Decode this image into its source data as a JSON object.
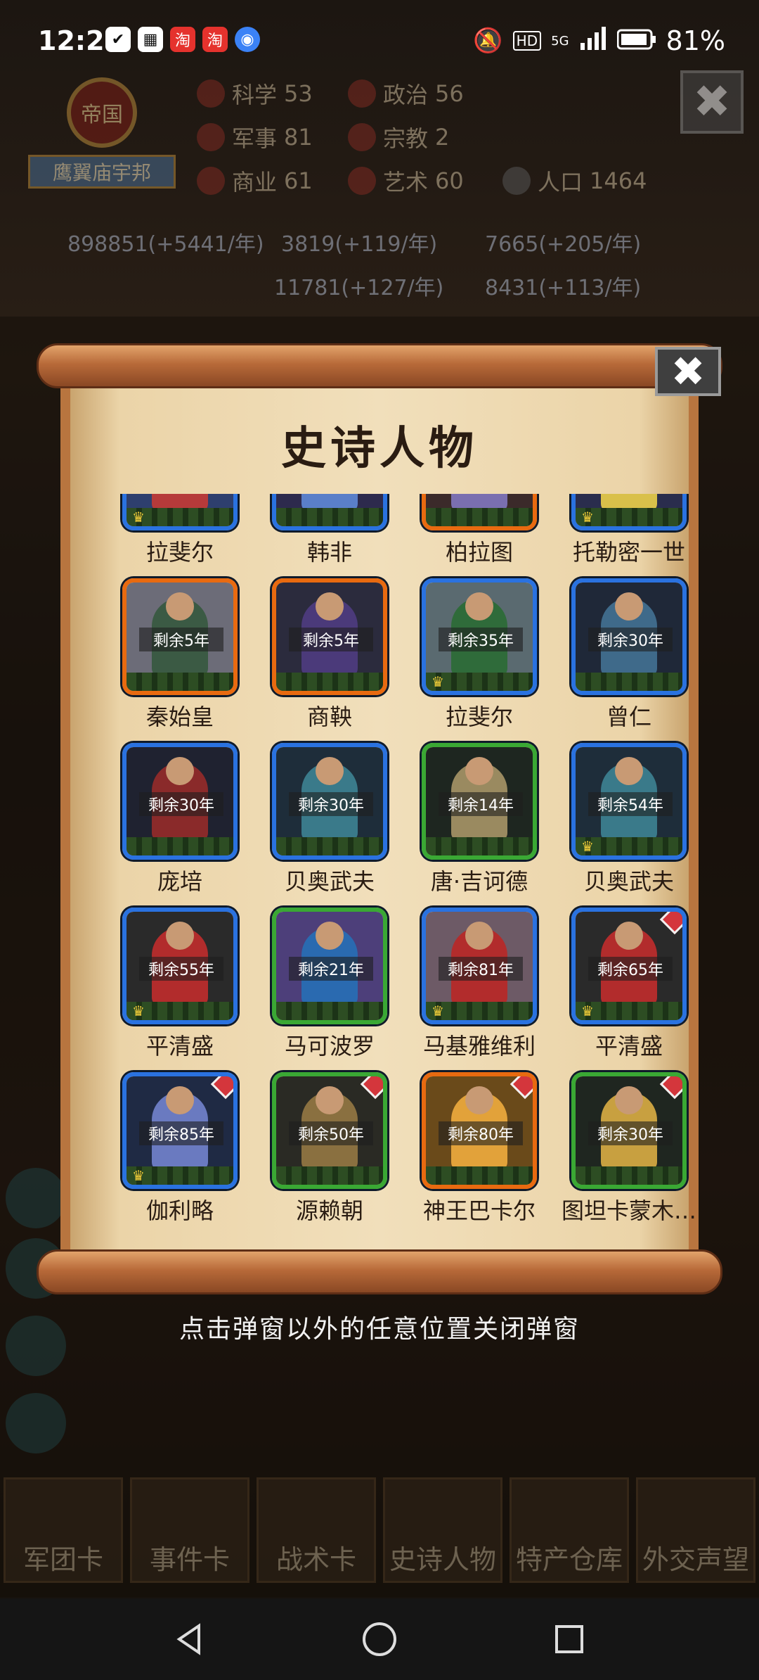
{
  "status_bar": {
    "time": "12:22",
    "battery": "81%",
    "network_label": "5G",
    "hd_label": "HD"
  },
  "hud": {
    "empire_badge": "帝国",
    "empire_name": "鹰翼庙宇邦",
    "stats": [
      {
        "label": "科学",
        "value": "53"
      },
      {
        "label": "政治",
        "value": "56"
      },
      {
        "label": "军事",
        "value": "81"
      },
      {
        "label": "宗教",
        "value": "2"
      },
      {
        "label": "商业",
        "value": "61"
      },
      {
        "label": "艺术",
        "value": "60"
      },
      {
        "label": "人口",
        "value": "1464"
      }
    ],
    "resources": [
      "898851(+5441/年)",
      "3819(+119/年)",
      "7665(+205/年)",
      "11781(+127/年)",
      "8431(+113/年)"
    ]
  },
  "popup": {
    "title": "史诗人物",
    "close_glyph": "✖",
    "heroes": [
      {
        "name": "拉斐尔",
        "remain": "",
        "frame": "blue",
        "crown": true,
        "gem": false,
        "colors": [
          "#2e3f6e",
          "#b63a3a"
        ]
      },
      {
        "name": "韩非",
        "remain": "",
        "frame": "blue",
        "crown": false,
        "gem": false,
        "colors": [
          "#2d2a4d",
          "#5a7fc9"
        ]
      },
      {
        "name": "柏拉图",
        "remain": "",
        "frame": "orange",
        "crown": false,
        "gem": false,
        "colors": [
          "#3b2a2a",
          "#7a6fb0"
        ]
      },
      {
        "name": "托勒密一世",
        "remain": "",
        "frame": "blue",
        "crown": true,
        "gem": false,
        "colors": [
          "#2a2d4d",
          "#d9c04a"
        ]
      },
      {
        "name": "秦始皇",
        "remain": "剩余5年",
        "frame": "orange",
        "crown": false,
        "gem": false,
        "colors": [
          "#6c6c78",
          "#3b5a44"
        ]
      },
      {
        "name": "商鞅",
        "remain": "剩余5年",
        "frame": "orange",
        "crown": false,
        "gem": false,
        "colors": [
          "#2b2b3d",
          "#4b3a7a"
        ]
      },
      {
        "name": "拉斐尔",
        "remain": "剩余35年",
        "frame": "blue",
        "crown": true,
        "gem": false,
        "colors": [
          "#5a6a70",
          "#2f6b3a"
        ]
      },
      {
        "name": "曾仁",
        "remain": "剩余30年",
        "frame": "blue",
        "crown": false,
        "gem": false,
        "colors": [
          "#1f2838",
          "#3f6a8a"
        ]
      },
      {
        "name": "庞培",
        "remain": "剩余30年",
        "frame": "blue",
        "crown": false,
        "gem": false,
        "colors": [
          "#1f2230",
          "#8a2a2a"
        ]
      },
      {
        "name": "贝奥武夫",
        "remain": "剩余30年",
        "frame": "blue",
        "crown": false,
        "gem": false,
        "colors": [
          "#1e2d3a",
          "#3a7a8a"
        ]
      },
      {
        "name": "唐·吉诃德",
        "remain": "剩余14年",
        "frame": "green",
        "crown": false,
        "gem": false,
        "colors": [
          "#1e2620",
          "#9a8a60"
        ]
      },
      {
        "name": "贝奥武夫",
        "remain": "剩余54年",
        "frame": "blue",
        "crown": true,
        "gem": false,
        "colors": [
          "#1e2d3a",
          "#3a7a8a"
        ]
      },
      {
        "name": "平清盛",
        "remain": "剩余55年",
        "frame": "blue",
        "crown": true,
        "gem": false,
        "colors": [
          "#2a2a2a",
          "#b22c2c"
        ]
      },
      {
        "name": "马可波罗",
        "remain": "剩余21年",
        "frame": "green",
        "crown": false,
        "gem": false,
        "colors": [
          "#4d3f7a",
          "#2a6ab0"
        ]
      },
      {
        "name": "马基雅维利",
        "remain": "剩余81年",
        "frame": "blue",
        "crown": true,
        "gem": false,
        "colors": [
          "#6d5a66",
          "#b22c2c"
        ]
      },
      {
        "name": "平清盛",
        "remain": "剩余65年",
        "frame": "blue",
        "crown": true,
        "gem": true,
        "colors": [
          "#2a2a2a",
          "#b22c2c"
        ]
      },
      {
        "name": "伽利略",
        "remain": "剩余85年",
        "frame": "blue",
        "crown": true,
        "gem": true,
        "colors": [
          "#1f2a44",
          "#6a7ac0"
        ]
      },
      {
        "name": "源赖朝",
        "remain": "剩余50年",
        "frame": "green",
        "crown": false,
        "gem": true,
        "colors": [
          "#2a2a24",
          "#8a7040"
        ]
      },
      {
        "name": "神王巴卡尔",
        "remain": "剩余80年",
        "frame": "orange",
        "crown": false,
        "gem": true,
        "colors": [
          "#6a4a1a",
          "#e2a23a"
        ]
      },
      {
        "name": "图坦卡蒙木…",
        "remain": "剩余30年",
        "frame": "green",
        "crown": false,
        "gem": true,
        "colors": [
          "#1f2620",
          "#c8a040"
        ]
      }
    ]
  },
  "hint": "点击弹窗以外的任意位置关闭弹窗",
  "bottom_tabs": [
    "军团卡",
    "事件卡",
    "战术卡",
    "史诗人物",
    "特产仓库",
    "外交声望"
  ],
  "colors": {
    "frame_blue": "#2a72e0",
    "frame_orange": "#e86a10",
    "frame_green": "#3aa834",
    "gem_red": "#d4363c",
    "paper": "#f1dfbb"
  }
}
